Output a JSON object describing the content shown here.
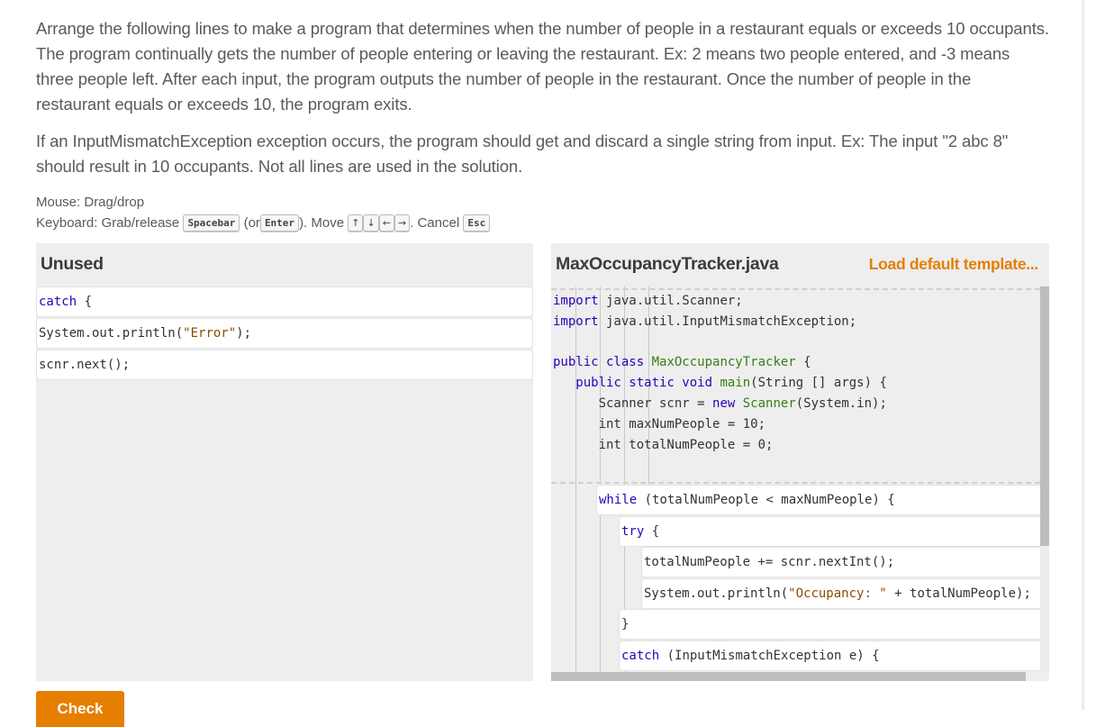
{
  "instructions": {
    "paragraph1": "Arrange the following lines to make a program that determines when the number of people in a restaurant equals or exceeds 10 occupants. The program continually gets the number of people entering or leaving the restaurant. Ex: 2 means two people entered, and -3 means three people left. After each input, the program outputs the number of people in the restaurant. Once the number of people in the restaurant equals or exceeds 10, the program exits.",
    "paragraph2": "If an InputMismatchException exception occurs, the program should get and discard a single string from input. Ex: The input \"2 abc 8\" should result in 10 occupants. Not all lines are used in the solution."
  },
  "help": {
    "mouse": "Mouse: Drag/drop",
    "keyboard_prefix": "Keyboard: Grab/release",
    "key_spacebar": "Spacebar",
    "or_open": "(or",
    "key_enter": "Enter",
    "move_label": "). Move",
    "key_up": "↑",
    "key_down": "↓",
    "key_left": "←",
    "key_right": "→",
    "cancel_label": ". Cancel",
    "key_esc": "Esc"
  },
  "unused": {
    "title": "Unused",
    "blocks": [
      {
        "kw": "catch",
        "rest": " {"
      },
      {
        "text": "System.out.println(",
        "str": "\"Error\"",
        "end": ");"
      },
      {
        "text": "scnr.next();"
      }
    ]
  },
  "editor": {
    "filename": "MaxOccupancyTracker.java",
    "load_template": "Load default template...",
    "fixed_lines": [
      {
        "kw": "import",
        "rest": " java.util.Scanner;"
      },
      {
        "kw": "import",
        "rest": " java.util.InputMismatchException;"
      },
      {
        "kw": "public class",
        "tp": " MaxOccupancyTracker",
        "rest": " {"
      },
      {
        "indent": "   ",
        "kw": "public static void",
        "tp": " main",
        "rest": "(String [] args) {"
      },
      {
        "indent": "      ",
        "text": "Scanner scnr = ",
        "kw": "new",
        "tp": " Scanner",
        "rest": "(System.in);"
      },
      {
        "indent": "      ",
        "text": "int maxNumPeople = 10;"
      },
      {
        "indent": "      ",
        "text": "int totalNumPeople = 0;"
      }
    ],
    "placed_blocks": [
      {
        "kw": "while",
        "rest": " (totalNumPeople < maxNumPeople) {"
      },
      {
        "kw": "try",
        "rest": " {"
      },
      {
        "text": "totalNumPeople += scnr.nextInt();"
      },
      {
        "text": "System.out.println(",
        "str": "\"Occupancy: \"",
        "end": " + totalNumPeople);"
      },
      {
        "text": "}"
      },
      {
        "kw": "catch",
        "rest": " (InputMismatchException e) {"
      }
    ]
  },
  "check_button": "Check"
}
